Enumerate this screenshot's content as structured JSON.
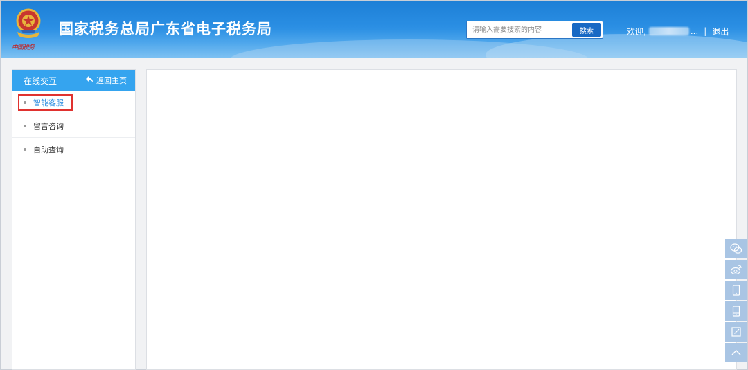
{
  "header": {
    "site_title": "国家税务总局广东省电子税务局",
    "motto": "中国税务",
    "search": {
      "placeholder": "请输入需要搜索的内容",
      "button_label": "搜索"
    },
    "welcome_label": "欢迎,",
    "username_suffix": "...",
    "separator": "|",
    "logout_label": "退出"
  },
  "sidebar": {
    "title": "在线交互",
    "back_label": "返回主页",
    "items": [
      {
        "label": "智能客服",
        "active": true
      },
      {
        "label": "留言咨询",
        "active": false
      },
      {
        "label": "自助查询",
        "active": false
      }
    ]
  },
  "floating_toolbar": {
    "icons": [
      "wechat-icon",
      "weibo-icon",
      "mobile-app-icon",
      "tablet-app-icon",
      "feedback-icon",
      "back-to-top-icon"
    ]
  },
  "colors": {
    "header_blue": "#2a8ee3",
    "sidebar_head": "#35a4ef",
    "active_item": "#2b8ee0",
    "highlight_red": "#e0322f",
    "float_btn": "#a9c5e4"
  }
}
